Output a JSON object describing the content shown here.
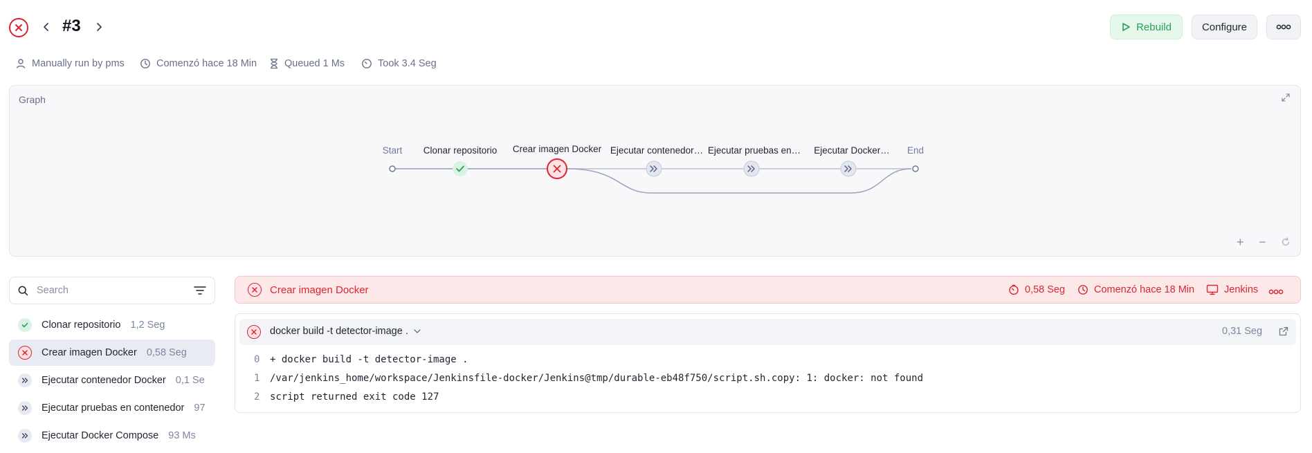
{
  "header": {
    "build_number": "#3",
    "rebuild_label": "Rebuild",
    "configure_label": "Configure",
    "more_label": "ooo"
  },
  "meta": {
    "run_by": "Manually run by pms",
    "started": "Comenzó hace 18 Min",
    "queued": "Queued 1 Ms",
    "took": "Took 3.4 Seg"
  },
  "graph": {
    "label": "Graph",
    "nodes": [
      {
        "label": "Start",
        "status": "start"
      },
      {
        "label": "Clonar repositorio",
        "status": "success"
      },
      {
        "label": "Crear imagen Docker",
        "status": "failed"
      },
      {
        "label": "Ejecutar contenedor…",
        "status": "skipped"
      },
      {
        "label": "Ejecutar pruebas en…",
        "status": "skipped"
      },
      {
        "label": "Ejecutar Docker…",
        "status": "skipped"
      },
      {
        "label": "End",
        "status": "end"
      }
    ],
    "zoom_in": "+",
    "zoom_out": "−"
  },
  "sidebar": {
    "search_placeholder": "Search",
    "items": [
      {
        "label": "Clonar repositorio",
        "duration": "1,2 Seg",
        "status": "success"
      },
      {
        "label": "Crear imagen Docker",
        "duration": "0,58 Seg",
        "status": "failed"
      },
      {
        "label": "Ejecutar contenedor Docker",
        "duration": "0,1 Se",
        "status": "skipped"
      },
      {
        "label": "Ejecutar pruebas en contenedor",
        "duration": "97",
        "status": "skipped"
      },
      {
        "label": "Ejecutar Docker Compose",
        "duration": "93 Ms",
        "status": "skipped"
      }
    ]
  },
  "stage_detail": {
    "title": "Crear imagen Docker",
    "duration": "0,58 Seg",
    "started": "Comenzó hace 18 Min",
    "agent": "Jenkins",
    "step": {
      "command": "docker build -t detector-image .",
      "duration": "0,31 Seg"
    },
    "log": [
      {
        "n": "0",
        "text": "+ docker build -t detector-image ."
      },
      {
        "n": "1",
        "text": "/var/jenkins_home/workspace/Jenkinsfile-docker/Jenkins@tmp/durable-eb48f750/script.sh.copy: 1: docker: not found"
      },
      {
        "n": "2",
        "text": "script returned exit code 127"
      }
    ]
  },
  "colors": {
    "fail": "#e0212e",
    "success": "#27a05a",
    "muted": "#69708a",
    "edge": "#9aa3bd"
  }
}
